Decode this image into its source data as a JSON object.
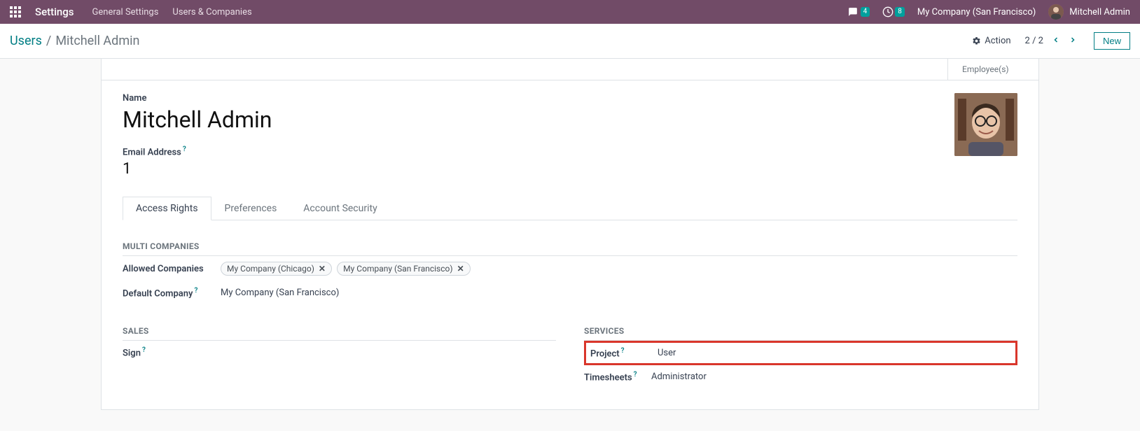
{
  "topbar": {
    "app_name": "Settings",
    "menus": [
      "General Settings",
      "Users & Companies"
    ],
    "messages_badge": "4",
    "activities_badge": "8",
    "company": "My Company (San Francisco)",
    "username": "Mitchell Admin"
  },
  "breadcrumb": {
    "parent": "Users",
    "current": "Mitchell Admin"
  },
  "controls": {
    "action_label": "Action",
    "pager": "2 / 2",
    "new_label": "New"
  },
  "stat": {
    "employees": "Employee(s)"
  },
  "form": {
    "name_label": "Name",
    "name_value": "Mitchell Admin",
    "email_label": "Email Address",
    "email_value": "1"
  },
  "tabs": [
    "Access Rights",
    "Preferences",
    "Account Security"
  ],
  "sections": {
    "multi": {
      "title": "MULTI COMPANIES",
      "allowed_label": "Allowed Companies",
      "allowed_tags": [
        "My Company (Chicago)",
        "My Company (San Francisco)"
      ],
      "default_label": "Default Company",
      "default_value": "My Company (San Francisco)"
    },
    "sales": {
      "title": "SALES",
      "sign_label": "Sign"
    },
    "services": {
      "title": "SERVICES",
      "project_label": "Project",
      "project_value": "User",
      "timesheets_label": "Timesheets",
      "timesheets_value": "Administrator"
    }
  }
}
